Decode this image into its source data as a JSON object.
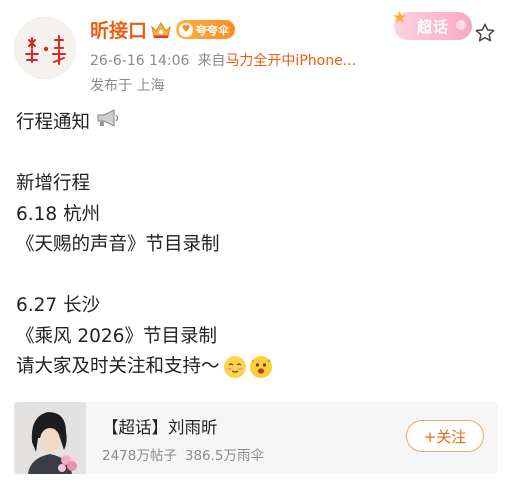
{
  "header": {
    "avatar_icon": "ornamental-seal-avatar-icon",
    "username": "昕接口",
    "crown_icon": "crown-badge-icon",
    "support_badge": {
      "icon": "heart-icon",
      "label": "夸夸伞"
    },
    "timestamp": "26-6-16 14:06",
    "source_prefix": "来自",
    "source": "马力全开中iPhone...",
    "location": "发布于 上海",
    "supertopic_tag": "超话",
    "star_icon": "star-outline-icon"
  },
  "post": {
    "lines": [
      {
        "text": "行程通知",
        "icon": "megaphone-icon"
      },
      {
        "text": ""
      },
      {
        "text": "新增行程"
      },
      {
        "text": "6.18 杭州"
      },
      {
        "text": "《天赐的声音》节目录制"
      },
      {
        "text": ""
      },
      {
        "text": "6.27 长沙"
      },
      {
        "text": "《乘风 2026》节目录制"
      },
      {
        "text": "请大家及时关注和支持～",
        "emojis": [
          "blush-emoji-icon",
          "excited-emoji-icon"
        ]
      }
    ]
  },
  "topic_card": {
    "thumbnail": "artist-photo-with-flowers",
    "title": "【超话】刘雨昕",
    "posts": "2478万帖子",
    "umbrellas": "386.5万雨伞",
    "follow_label": "+关注"
  },
  "colors": {
    "accent_orange": "#ea5d15",
    "meta_gray": "#8a8a8a",
    "card_bg": "#f6f6f6",
    "tag_pink": "#f7a8c4"
  }
}
